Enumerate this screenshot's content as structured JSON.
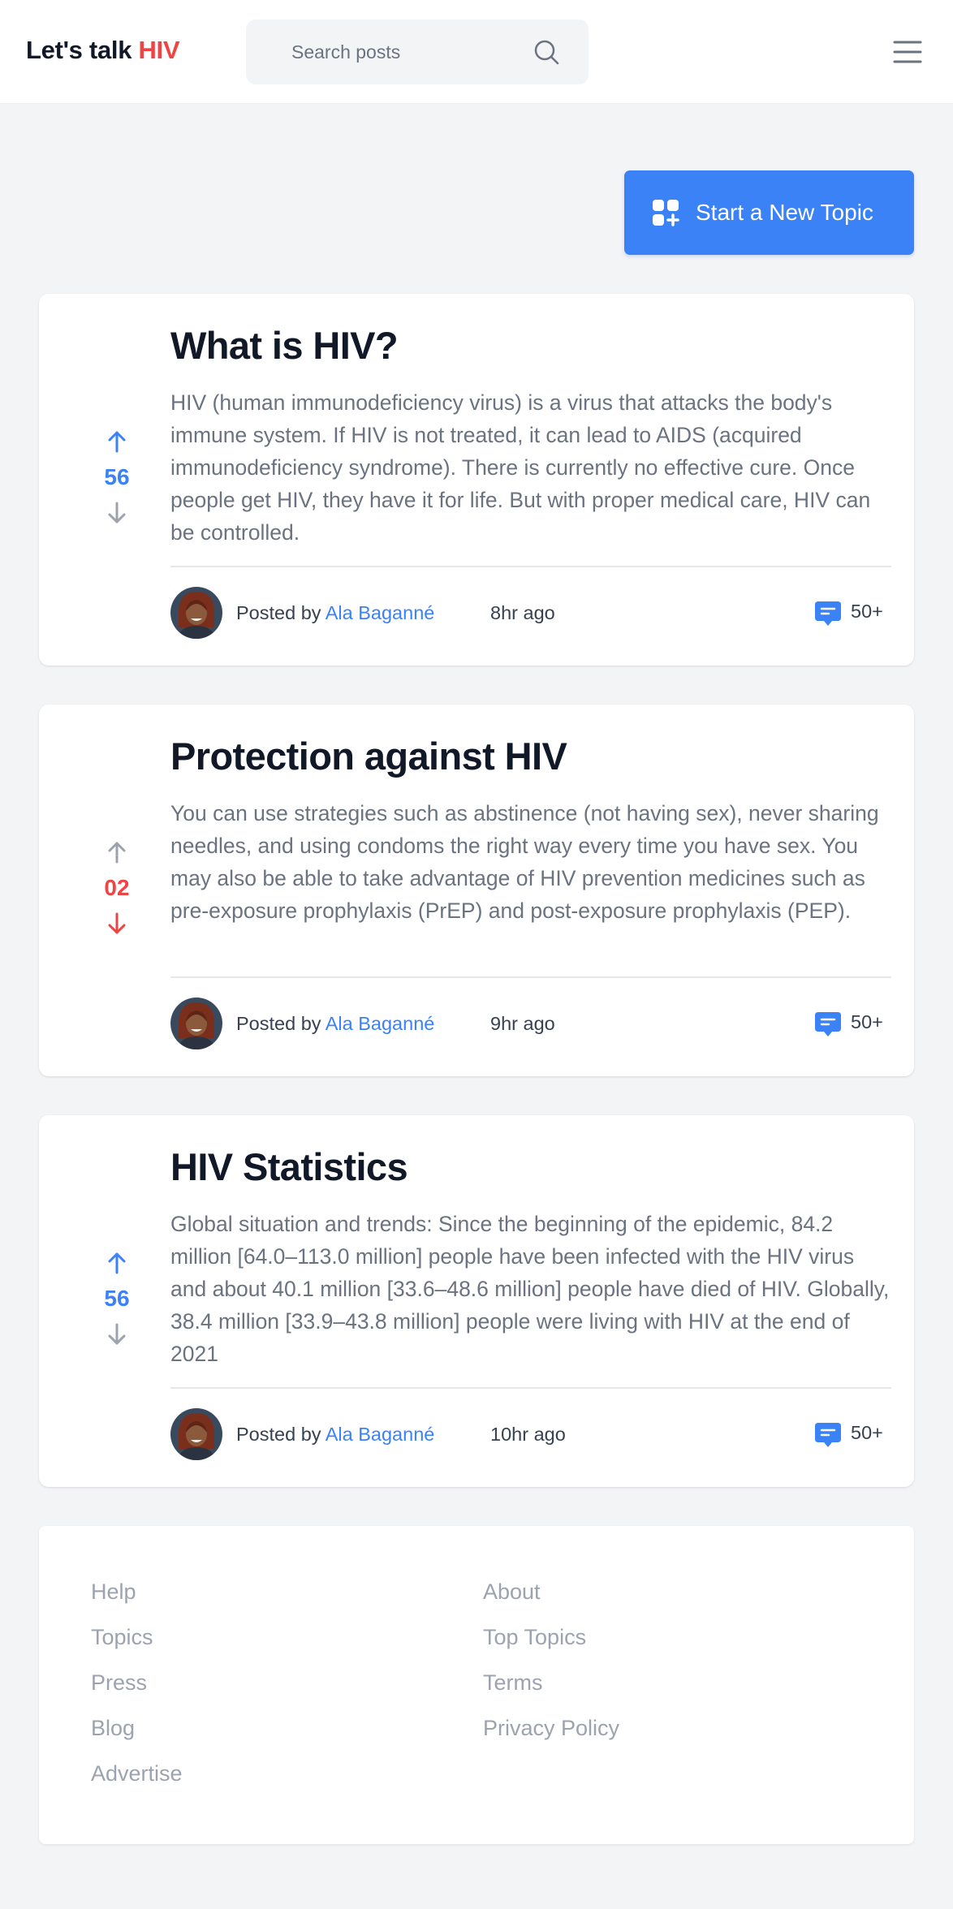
{
  "header": {
    "logo_text": "Let's talk ",
    "logo_accent": "HIV",
    "search_placeholder": "Search posts",
    "search_icon": "search-icon",
    "menu_icon": "hamburger-menu-icon"
  },
  "actions": {
    "new_topic_label": "Start a New Topic",
    "new_topic_icon": "grid-plus-icon"
  },
  "posts": [
    {
      "title": "What is HIV?",
      "body": "HIV (human immunodeficiency virus) is a virus that attacks the body's immune system. If HIV is not treated, it can lead to AIDS (acquired immunodeficiency syndrome). There is currently no effective cure. Once people get HIV, they have it for life. But with proper medical care, HIV can be controlled.",
      "votes": "56",
      "vote_state": "up",
      "posted_by_label": "Posted by ",
      "author": "Ala Baganné",
      "time": "8hr ago",
      "comments": "50+"
    },
    {
      "title": "Protection against HIV",
      "body": "You can use strategies such as abstinence (not having sex), never sharing needles, and using condoms the right way every time you have sex. You may also be able to take advantage of HIV prevention medicines such as pre-exposure prophylaxis (PrEP) and post-exposure prophylaxis (PEP).",
      "votes": "02",
      "vote_state": "down",
      "posted_by_label": "Posted by ",
      "author": "Ala Baganné",
      "time": "9hr ago",
      "comments": "50+"
    },
    {
      "title": "HIV Statistics",
      "body": "Global situation and trends: Since the beginning of the epidemic, 84.2 million [64.0–113.0 million] people have been infected with the HIV virus and about 40.1 million [33.6–48.6 million] people have died of HIV. Globally, 38.4 million [33.9–43.8 million] people were living with HIV at the end of 2021",
      "votes": "56",
      "vote_state": "up",
      "posted_by_label": "Posted by ",
      "author": "Ala Baganné",
      "time": "10hr ago",
      "comments": "50+"
    }
  ],
  "footer": {
    "links": [
      "Help",
      "Topics",
      "Press",
      "Blog",
      "Advertise",
      "About",
      "Top Topics",
      "Terms",
      "Privacy Policy"
    ]
  },
  "colors": {
    "accent_blue": "#3b82f6",
    "accent_red": "#ef4444",
    "neutral_arrow": "#9ca3af"
  }
}
